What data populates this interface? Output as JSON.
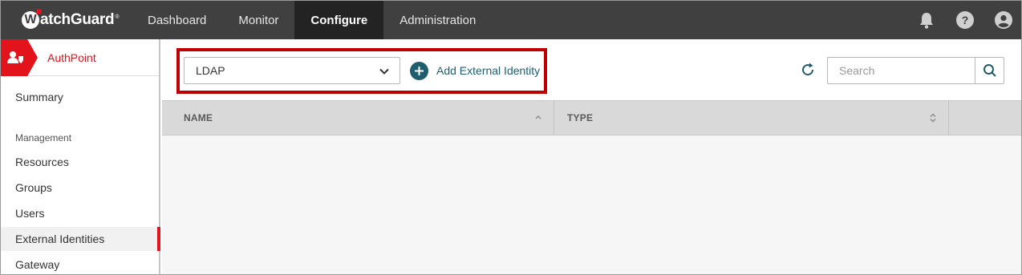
{
  "brand": {
    "logo_letter": "W",
    "logo_text": "atchGuard",
    "trademark": "®"
  },
  "nav": {
    "items": [
      {
        "label": "Dashboard",
        "active": false
      },
      {
        "label": "Monitor",
        "active": false
      },
      {
        "label": "Configure",
        "active": true
      },
      {
        "label": "Administration",
        "active": false
      }
    ]
  },
  "top_icons": {
    "notifications": "bell-icon",
    "help": "help-icon",
    "help_glyph": "?",
    "account": "user-icon"
  },
  "sidebar": {
    "app_name": "AuthPoint",
    "summary": "Summary",
    "section_management": "Management",
    "items": [
      {
        "label": "Resources",
        "active": false
      },
      {
        "label": "Groups",
        "active": false
      },
      {
        "label": "Users",
        "active": false
      },
      {
        "label": "External Identities",
        "active": true
      },
      {
        "label": "Gateway",
        "active": false
      }
    ]
  },
  "toolbar": {
    "identity_type_selected": "LDAP",
    "add_label": "Add External Identity",
    "search_placeholder": "Search"
  },
  "table": {
    "columns": [
      {
        "label": "NAME",
        "sort": "ascending"
      },
      {
        "label": "TYPE",
        "sort": "none"
      }
    ],
    "rows": []
  },
  "colors": {
    "brand_red": "#e3131b",
    "topbar": "#404040",
    "accent_teal": "#1f5d6e",
    "highlight": "#c00000"
  }
}
